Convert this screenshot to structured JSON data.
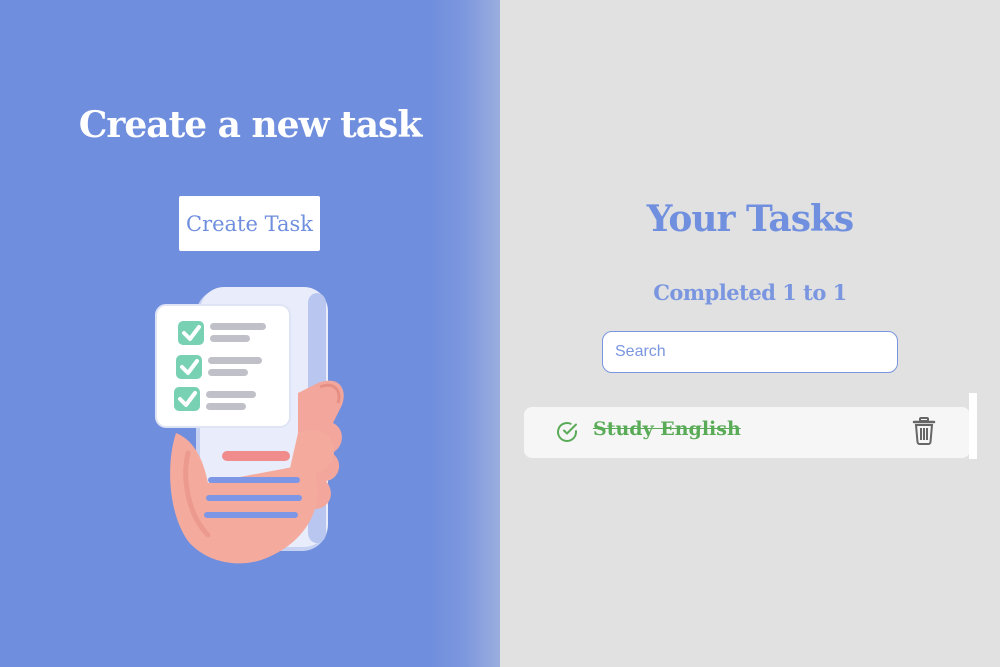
{
  "left_panel": {
    "heading": "Create a new task",
    "create_button_label": "Create Task",
    "illustration_icon": "phone-checklist-illustration"
  },
  "right_panel": {
    "heading": "Your Tasks",
    "completed_summary": "Completed 1 to 1",
    "search": {
      "placeholder": "Search",
      "value": ""
    },
    "tasks": [
      {
        "title": "Study English",
        "completed": true,
        "status_icon": "check-circle-icon",
        "delete_icon": "trash-icon"
      }
    ]
  },
  "colors": {
    "left_background": "#6f8edd",
    "right_background": "#e1e1e1",
    "accent": "#7090df",
    "completed_text": "#5aab58",
    "white": "#ffffff"
  }
}
